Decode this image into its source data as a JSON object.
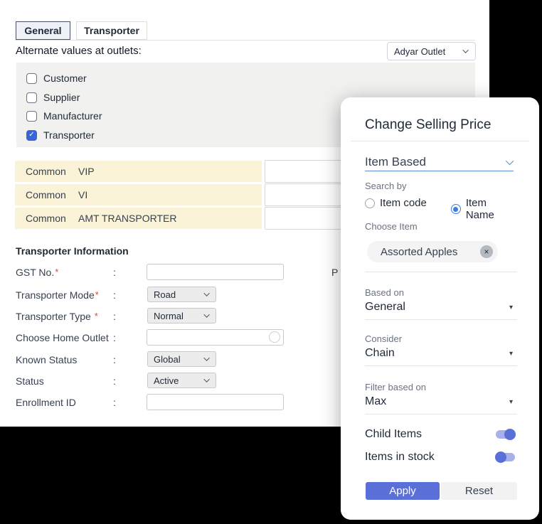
{
  "tabs": [
    {
      "label": "General",
      "active": true
    },
    {
      "label": "Transporter",
      "active": false
    }
  ],
  "header": {
    "alternate_label": "Alternate values at outlets:",
    "outlet_select": {
      "value": "Adyar Outlet"
    }
  },
  "checkbox_panel": {
    "items": [
      {
        "label": "Customer",
        "checked": false
      },
      {
        "label": "Supplier",
        "checked": false
      },
      {
        "label": "Manufacturer",
        "checked": false
      },
      {
        "label": "Transporter",
        "checked": true
      }
    ]
  },
  "common_rows": [
    {
      "scope": "Common",
      "value": "VIP"
    },
    {
      "scope": "Common",
      "value": "VI"
    },
    {
      "scope": "Common",
      "value": "AMT TRANSPORTER"
    }
  ],
  "transporter": {
    "heading": "Transporter Information",
    "colon": ":",
    "required_mark": "*",
    "clipped_text": "P",
    "fields": [
      {
        "label": "GST No.",
        "required": true,
        "type": "input",
        "value": ""
      },
      {
        "label": "Transporter Mode",
        "required": true,
        "type": "select",
        "value": "Road"
      },
      {
        "label": "Transporter Type ",
        "required": true,
        "type": "select",
        "value": "Normal"
      },
      {
        "label": "Choose Home Outlet",
        "required": false,
        "type": "input",
        "value": ""
      },
      {
        "label": "Known Status",
        "required": false,
        "type": "select",
        "value": "Global"
      },
      {
        "label": "Status",
        "required": false,
        "type": "select",
        "value": "Active"
      },
      {
        "label": "Enrollment ID",
        "required": false,
        "type": "input",
        "value": ""
      }
    ]
  },
  "modal": {
    "title": "Change Selling Price",
    "mode_select": {
      "value": "Item Based"
    },
    "search_by": {
      "label": "Search by",
      "options": [
        {
          "label": "Item code",
          "selected": false
        },
        {
          "label": "Item Name",
          "selected": true
        }
      ]
    },
    "choose_item": {
      "label": "Choose Item",
      "chip_text": "Assorted Apples"
    },
    "dropdowns": [
      {
        "label": "Based on",
        "value": "General"
      },
      {
        "label": "Consider",
        "value": "Chain"
      },
      {
        "label": "Filter based on",
        "value": "Max"
      }
    ],
    "toggles": [
      {
        "label": "Child Items",
        "on": true
      },
      {
        "label": "Items in stock",
        "on": false
      }
    ],
    "actions": {
      "apply_label": "Apply",
      "reset_label": "Reset"
    }
  },
  "icons": {
    "check": "✓",
    "triangle_down": "▾",
    "close": "×"
  },
  "colors": {
    "accent_indigo": "#5b6fd8",
    "toggle_track": "#a6b0ea",
    "checkbox_checked": "#3866d8",
    "radio_selected": "#3b7de0",
    "mode_underline": "#5b8cd9",
    "row_highlight": "#faf3d8",
    "required_red": "#e0443a"
  }
}
